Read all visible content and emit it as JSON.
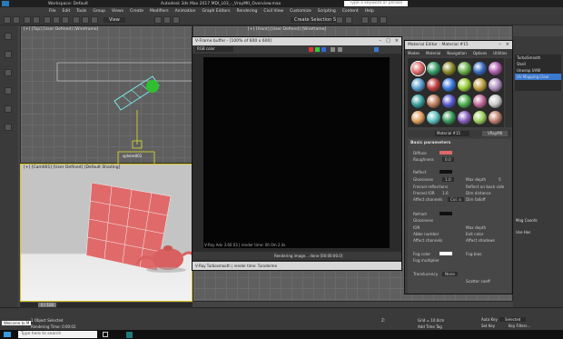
{
  "titlebar": {
    "workspace": "Workspace: Default",
    "title": "Autodesk 3ds Max 2017     MDI_L03_-_VrayMtl_Overview.max",
    "search": "Type a keyword or phrase"
  },
  "menu": [
    "File",
    "Edit",
    "Tools",
    "Group",
    "Views",
    "Create",
    "Modifiers",
    "Animation",
    "Graph Editors",
    "Rendering",
    "Civil View",
    "Customize",
    "Scripting",
    "Content",
    "Help"
  ],
  "toolbar": {
    "selection_set": "Create Selection Se",
    "view_dropdown": "View"
  },
  "viewports": {
    "top_left": "[+] [Top] [User Defined] [Wireframe]",
    "top_right": "[+] [Front] [User Defined] [Wireframe]",
    "camera": "[+] [Cam001] [User Defined] [Default Shading]",
    "object_label": "sphere001"
  },
  "vfb": {
    "title": "V-Frame buffer - [100% of 600 x 600]",
    "channel": "RGB color",
    "bottom_text": "V-Ray Adv 3.60.03 | render time: 0h 0m 2.4s",
    "progress_text": "Rendering image... done [00:00:00.0]",
    "status": "V-Ray Turbosmooth | render time: Turoderme"
  },
  "material_editor": {
    "title": "Material Editor - Material #15",
    "menu": [
      "Modes",
      "Material",
      "Navigation",
      "Options",
      "Utilities"
    ],
    "material_name": "Material #15",
    "material_type": "VRayMtl",
    "rollout": "Basic parameters",
    "params": {
      "diffuse": "Diffuse",
      "roughness": "Roughness",
      "roughness_val": "0.0",
      "reflect": "Reflect",
      "glossiness": "Glossiness",
      "gloss_val": "1.0",
      "max_depth": "Max depth",
      "max_depth_val": "5",
      "fresnel": "Fresnel reflections",
      "fresnel_ior": "Fresnel IOR",
      "ior_val": "1.6",
      "reflect_back": "Reflect on back side",
      "dim_distance": "Dim distance",
      "affect_channels": "Affect channels",
      "affect_val": "Col. o",
      "dim_falloff": "Dim falloff",
      "refract": "Refract",
      "abbe": "Abbe number",
      "exit_color": "Exit color",
      "affect_shadows": "Affect shadows",
      "ior": "IOR",
      "fog_color": "Fog color",
      "fog_bias": "Fog bias",
      "fog_multiplier": "Fog multiplier",
      "translucency": "Translucency",
      "translucency_val": "None",
      "scatter": "Scatter coeff"
    }
  },
  "right_panel": {
    "items": [
      "TurboSmooth",
      "Shell",
      "Unwrap UVW",
      "UV Mapping Clear"
    ],
    "launch": "Mog Coords",
    "use_hs": "Use Has"
  },
  "status": {
    "selected": "1 Object Selected",
    "rendering_time": "Rendering Time: 0:00:02",
    "frame": "0 / 100",
    "z": "Z:",
    "grid": "Grid = 10.0cm",
    "add_key": "Add Time Tag",
    "autokey": "Auto Key",
    "selected_mode": "Selected",
    "set_key": "Set Key",
    "key_filters": "Key Filters...",
    "welcome": "Welcome to M"
  },
  "taskbar": {
    "search": "Type here to search"
  },
  "colors": {
    "diffuse": "#e06868",
    "background": "#444444"
  }
}
